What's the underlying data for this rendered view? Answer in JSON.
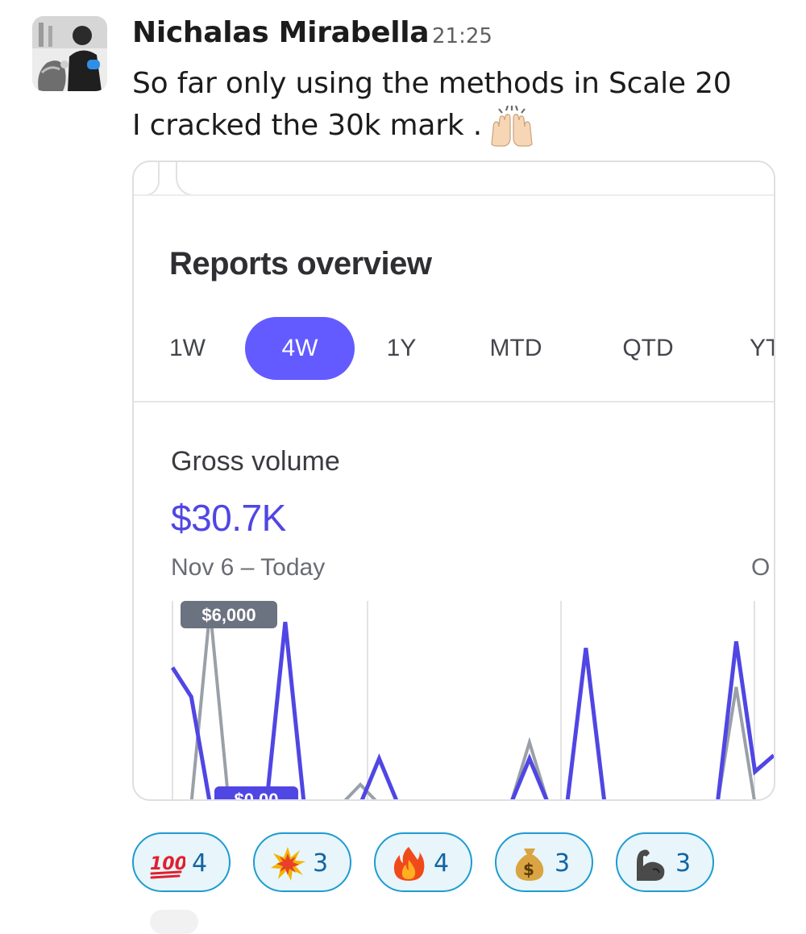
{
  "message": {
    "author": "Nichalas Mirabella",
    "time": "21:25",
    "lines": [
      "So far only using the methods in Scale 20",
      "I cracked the 30k mark ."
    ],
    "trailing_emoji": "raised-hands-icon"
  },
  "attachment": {
    "title": "Reports overview",
    "tabs": [
      {
        "label": "1W",
        "active": false
      },
      {
        "label": "4W",
        "active": true
      },
      {
        "label": "1Y",
        "active": false
      },
      {
        "label": "MTD",
        "active": false
      },
      {
        "label": "QTD",
        "active": false
      },
      {
        "label": "YT",
        "active": false
      }
    ],
    "metric": {
      "label": "Gross volume",
      "value": "$30.7K",
      "range": "Nov 6 – Today",
      "right_cut": "O"
    },
    "colors": {
      "accent": "#635bff",
      "value": "#5046e4",
      "current_line": "#5046e4",
      "previous_line": "#9aa0a8"
    }
  },
  "chart_data": {
    "type": "line",
    "annotations": [
      "$6,000",
      "$0.00"
    ],
    "series": [
      {
        "values": [
          4200,
          3300,
          0,
          0,
          0,
          0,
          5600,
          0,
          0,
          0,
          0,
          1400,
          0,
          0,
          0,
          0,
          0,
          0,
          0,
          1400,
          0,
          0,
          4800,
          0,
          0,
          0,
          0,
          0,
          0,
          0,
          5000,
          1000,
          1500
        ]
      },
      {
        "values": [
          0,
          0,
          6000,
          0,
          0,
          0,
          0,
          0,
          0,
          0,
          600,
          0,
          0,
          0,
          0,
          0,
          0,
          0,
          0,
          1900,
          0,
          0,
          0,
          0,
          0,
          0,
          0,
          0,
          0,
          0,
          3600,
          0,
          0
        ]
      }
    ]
  },
  "reactions": [
    {
      "emoji": "hundred-points-icon",
      "count": "4"
    },
    {
      "emoji": "collision-icon",
      "count": "3"
    },
    {
      "emoji": "fire-icon",
      "count": "4"
    },
    {
      "emoji": "money-bag-icon",
      "count": "3"
    },
    {
      "emoji": "flexed-biceps-icon",
      "count": "3"
    }
  ]
}
